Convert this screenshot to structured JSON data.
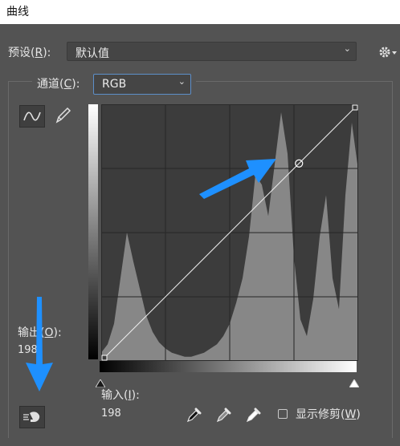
{
  "window": {
    "title": "曲线"
  },
  "preset": {
    "label": "预设",
    "mnemonic": "R",
    "value": "默认值"
  },
  "channel": {
    "label": "通道",
    "mnemonic": "C",
    "value": "RGB"
  },
  "output": {
    "label_prefix": "输出",
    "label_suffix": "",
    "mnemonic": "O",
    "value": "198"
  },
  "input": {
    "label": "输入",
    "mnemonic": "I",
    "value": "198"
  },
  "show_clipping": {
    "label": "显示修剪",
    "mnemonic": "W",
    "checked": false
  },
  "icons": {
    "gear": "gear-icon",
    "curve_tool": "curve-edit-icon",
    "pencil_tool": "pencil-icon",
    "target_adjust": "target-adjust-icon",
    "eyedroppers": [
      "black-point-eyedropper-icon",
      "gray-point-eyedropper-icon",
      "white-point-eyedropper-icon"
    ]
  },
  "colors": {
    "annotation_arrow": "#1e90ff",
    "panel_bg": "#535353",
    "graph_bg": "#3c3c3c",
    "histogram": "#878787"
  },
  "curve": {
    "points": [
      [
        0,
        0
      ],
      [
        198,
        198
      ],
      [
        255,
        255
      ]
    ],
    "selected_point": [
      198,
      198
    ]
  },
  "histogram": [
    4,
    8,
    18,
    40,
    62,
    48,
    35,
    22,
    14,
    9,
    6,
    4,
    3,
    2,
    2,
    3,
    4,
    6,
    8,
    12,
    18,
    28,
    40,
    60,
    90,
    85,
    70,
    95,
    120,
    100,
    50,
    20,
    12,
    30,
    60,
    80,
    40,
    25,
    80,
    115,
    92
  ]
}
